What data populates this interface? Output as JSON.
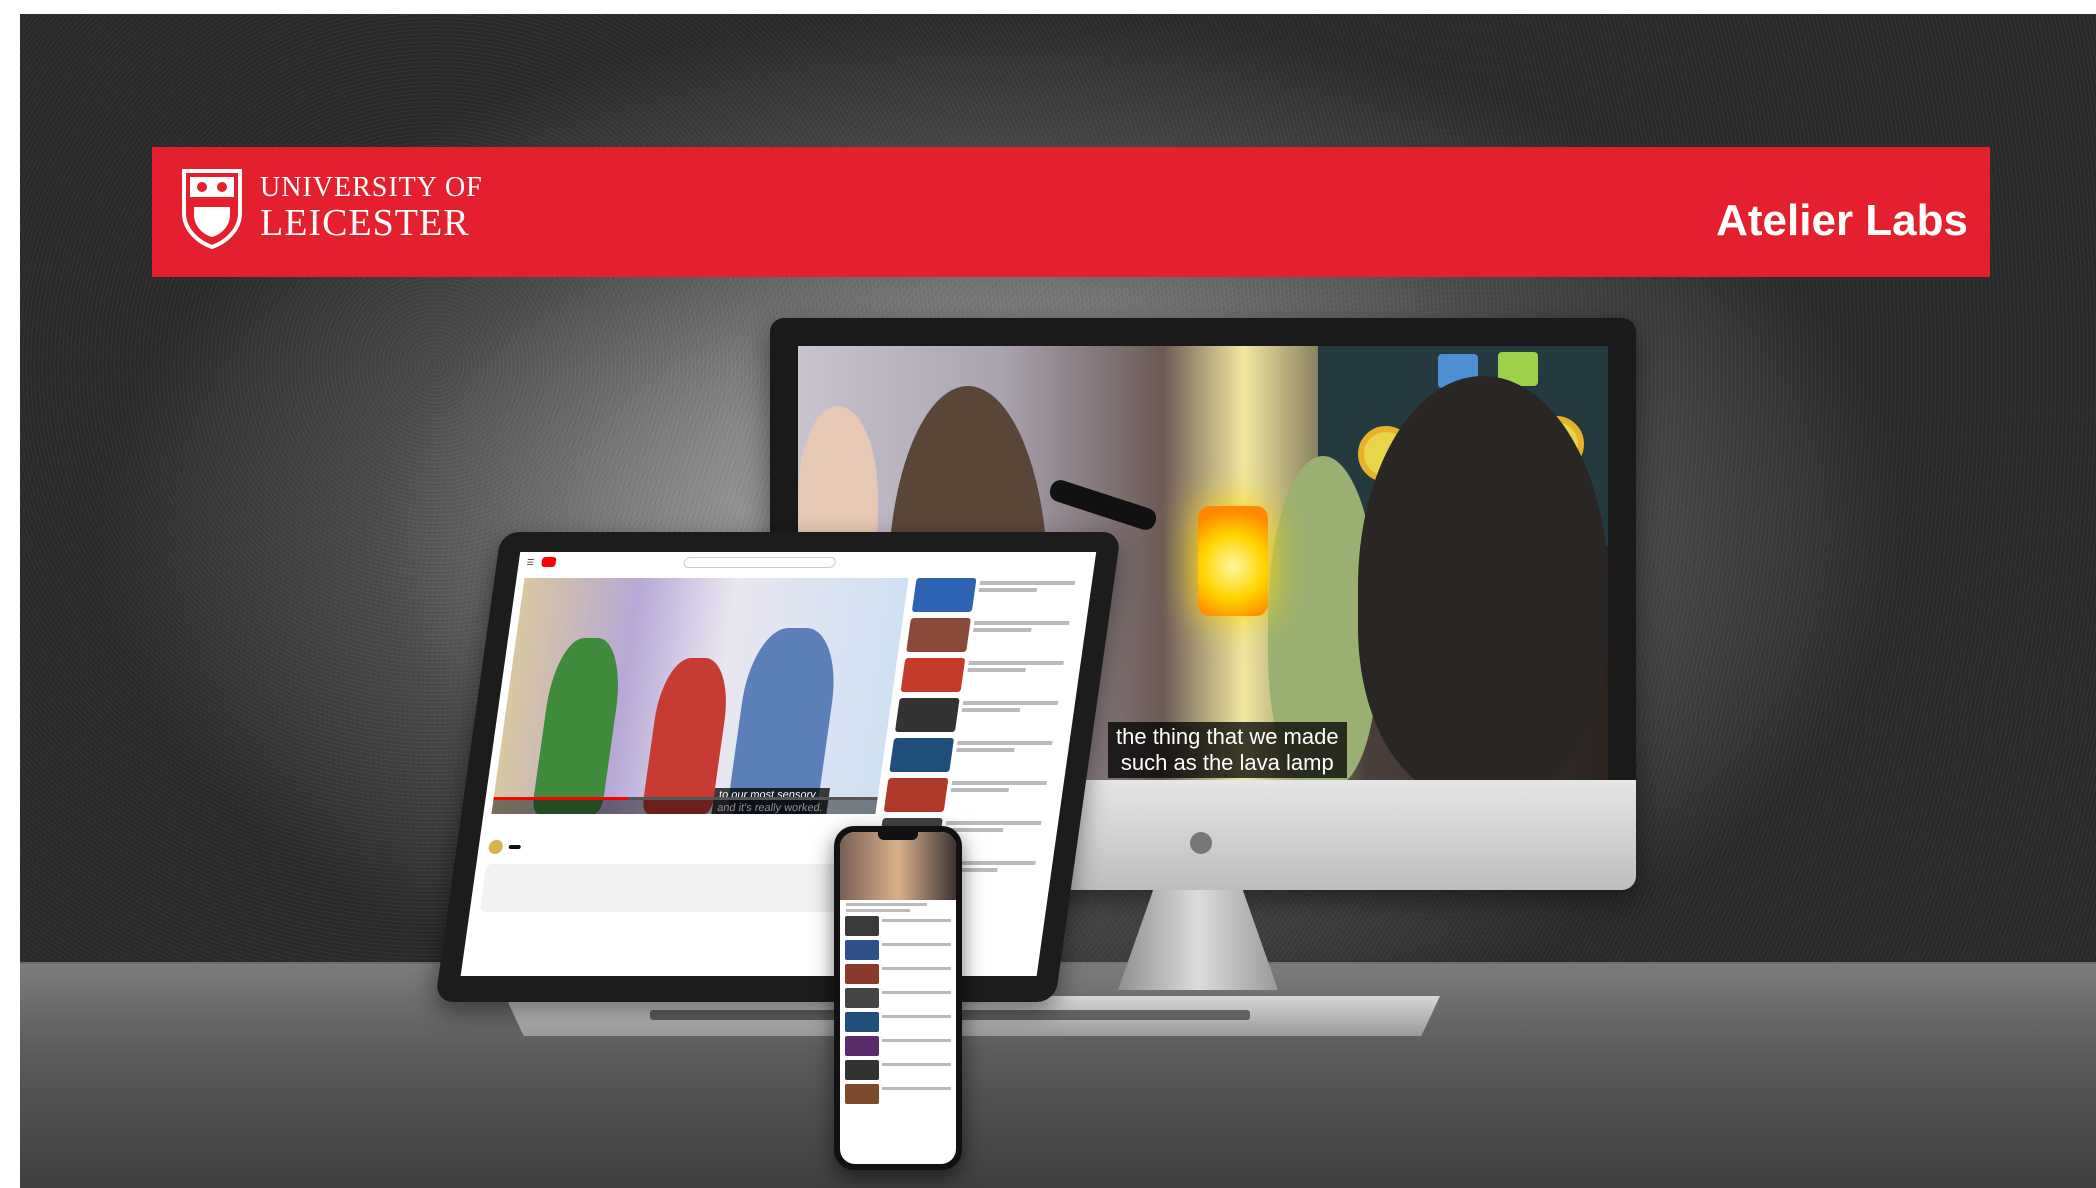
{
  "banner": {
    "university_line1": "UNIVERSITY OF",
    "university_line2": "LEICESTER",
    "brand": "Atelier Labs",
    "color": "#e4202e"
  },
  "monitor": {
    "caption_line1": "the thing that we made",
    "caption_line2": "such as the lava lamp"
  },
  "laptop": {
    "video_caption_line1": "to our most sensory",
    "video_caption_line2": "and it's really worked."
  }
}
